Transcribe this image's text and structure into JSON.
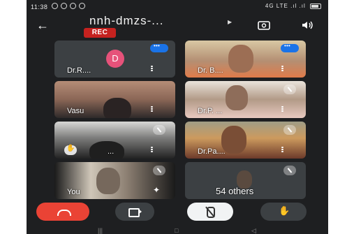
{
  "status_bar": {
    "time": "11:38",
    "right": "4G LTE .ıl  .ıl"
  },
  "header": {
    "back_icon": "arrow-left-icon",
    "meeting_code": "nnh-dmzs-...",
    "recording_badge": "REC"
  },
  "tiles": [
    {
      "name": "Dr.R....",
      "avatar_letter": "D",
      "avatar_color": "#e6527a",
      "speaking": true,
      "muted": false
    },
    {
      "name": "Dr. B....",
      "speaking": true,
      "muted": false
    },
    {
      "name": "Vasu",
      "muted": false
    },
    {
      "name": "Dr.P. ...",
      "muted": true
    },
    {
      "name": "...",
      "muted": true,
      "hand_raised": true
    },
    {
      "name": "Dr.Pa....",
      "muted": true
    },
    {
      "name": "You",
      "muted": true
    },
    {
      "name": "54 others",
      "muted": true
    }
  ],
  "controls": {
    "end_call": "call-end-icon",
    "camera": "videocam-icon",
    "microphone": "mic-off-icon",
    "raise_hand": "hand-icon",
    "more": "more-vert-icon"
  },
  "colors": {
    "end_call": "#ea4335",
    "rec_badge": "#c5221f",
    "speaking_indicator": "#1a73e8",
    "background": "#1e1f21"
  }
}
